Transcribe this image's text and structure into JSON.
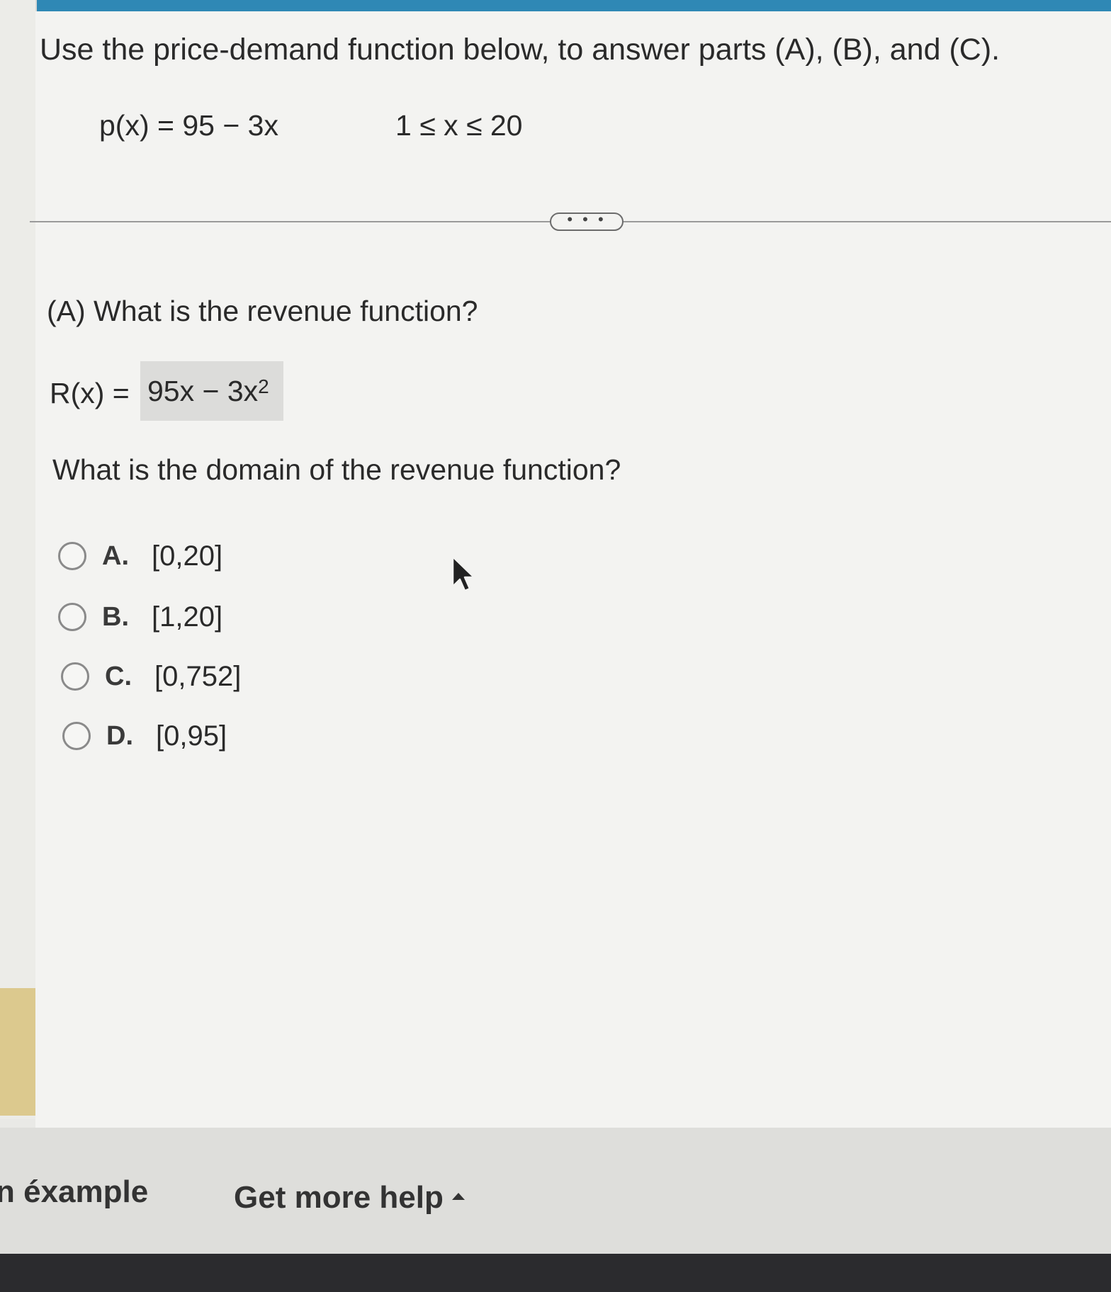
{
  "intro": "Use the price-demand function below, to answer parts (A), (B), and (C).",
  "equation": "p(x) = 95 − 3x",
  "constraint": "1 ≤ x ≤ 20",
  "more_button": "• • •",
  "part_a": {
    "question": "(A) What is the revenue function?",
    "r_label": "R(x) =",
    "answer_base": "95x − 3x",
    "answer_exp": "2"
  },
  "domain_question": "What is the domain of the revenue function?",
  "choices": [
    {
      "letter": "A.",
      "value": "[0,20]"
    },
    {
      "letter": "B.",
      "value": "[1,20]"
    },
    {
      "letter": "C.",
      "value": "[0,752]"
    },
    {
      "letter": "D.",
      "value": "[0,95]"
    }
  ],
  "footer": {
    "example": "n éxample",
    "help": "Get more help"
  }
}
